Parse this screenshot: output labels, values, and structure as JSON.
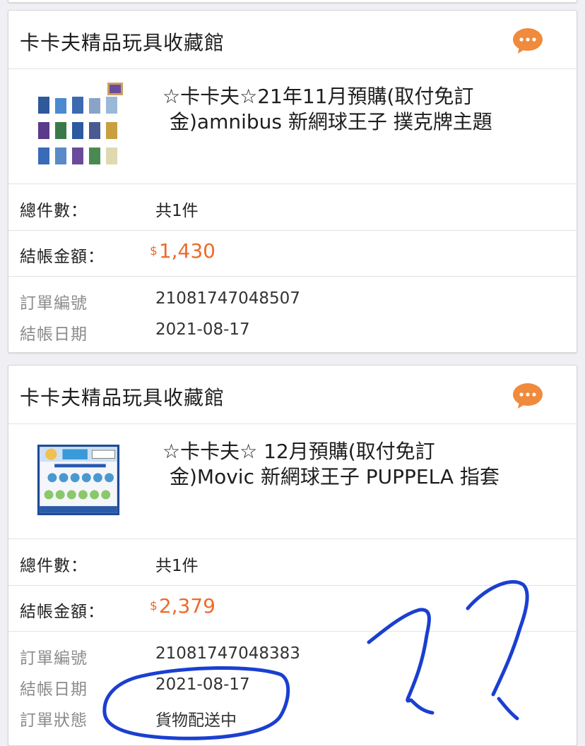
{
  "orders": [
    {
      "shop_name": "卡卡夫精品玩具收藏館",
      "product_title_line1": "☆卡卡夫☆21年11月預購(取付免訂",
      "product_title_line2": "金)amnibus 新網球王子 撲克牌主題",
      "qty_label": "總件數：",
      "qty_value": "共1件",
      "total_label": "結帳金額：",
      "currency_symbol": "$",
      "total_value": "1,430",
      "order_no_label": "訂單編號",
      "order_no_value": "21081747048507",
      "date_label": "結帳日期",
      "date_value": "2021-08-17"
    },
    {
      "shop_name": "卡卡夫精品玩具收藏館",
      "product_title_line1": "☆卡卡夫☆ 12月預購(取付免訂",
      "product_title_line2": "金)Movic 新網球王子 PUPPELA 指套",
      "qty_label": "總件數：",
      "qty_value": "共1件",
      "total_label": "結帳金額：",
      "currency_symbol": "$",
      "total_value": "2,379",
      "order_no_label": "訂單編號",
      "order_no_value": "21081747048383",
      "date_label": "結帳日期",
      "date_value": "2021-08-17",
      "status_label": "訂單狀態",
      "status_value": "貨物配送中"
    }
  ],
  "icons": {
    "chat": "chat-bubble-icon"
  },
  "colors": {
    "accent": "#ee6a2a",
    "chat": "#f08a3c",
    "annotation": "#1a3fd0"
  }
}
